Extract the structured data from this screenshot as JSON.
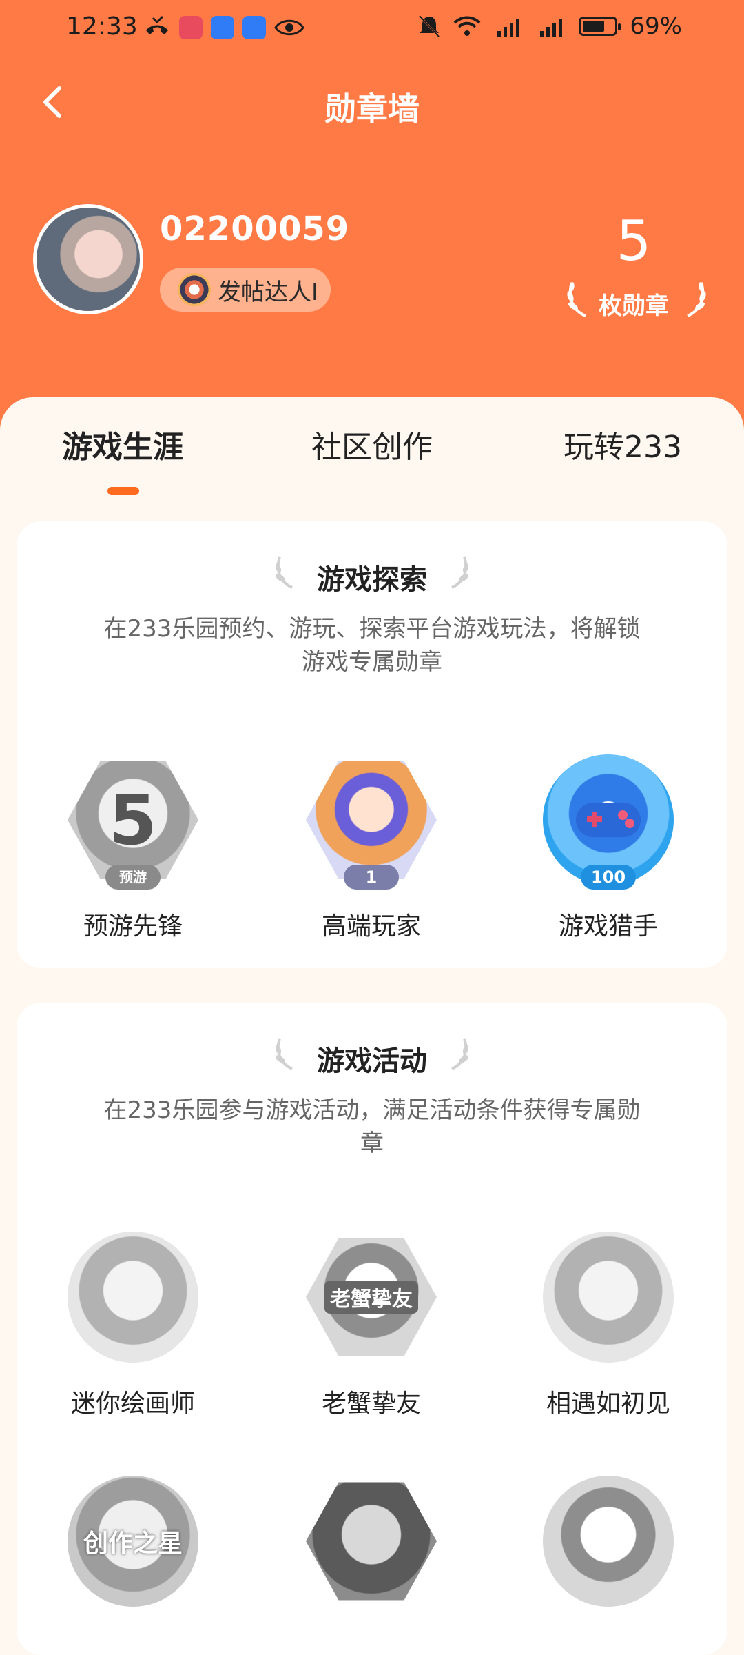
{
  "status_bar": {
    "time": "12:33",
    "battery_pct": "69%",
    "battery_level": 0.69
  },
  "header": {
    "title": "勋章墙"
  },
  "profile": {
    "user_id": "02200059",
    "badge_tag": "发帖达人I",
    "medal_count": "5",
    "medal_count_label": "枚勋章"
  },
  "tabs": [
    {
      "label": "游戏生涯",
      "active": true
    },
    {
      "label": "社区创作",
      "active": false
    },
    {
      "label": "玩转233",
      "active": false
    }
  ],
  "sections": [
    {
      "title": "游戏探索",
      "description": "在233乐园预约、游玩、探索平台游戏玩法，将解锁游戏专属勋章",
      "badges": [
        {
          "name": "预游先锋",
          "icon": "number-five-badge-icon",
          "overlay": "5",
          "sub": "预游"
        },
        {
          "name": "高端玩家",
          "icon": "vr-player-badge-icon",
          "level": "1"
        },
        {
          "name": "游戏猎手",
          "icon": "gamepad-badge-icon",
          "level": "100"
        }
      ]
    },
    {
      "title": "游戏活动",
      "description": "在233乐园参与游戏活动，满足活动条件获得专属勋章",
      "badges": [
        {
          "name": "迷你绘画师",
          "icon": "painter-girl-badge-icon"
        },
        {
          "name": "老蟹挚友",
          "icon": "burger-badge-icon",
          "overlay": "老蟹挚友"
        },
        {
          "name": "相遇如初见",
          "icon": "anime-girl-badge-icon"
        },
        {
          "name": "",
          "icon": "creation-star-badge-icon",
          "overlay": "创作之星"
        },
        {
          "name": "",
          "icon": "heroes-badge-icon"
        },
        {
          "name": "",
          "icon": "princess-badge-icon"
        }
      ]
    }
  ],
  "colors": {
    "brand": "#FF7A45",
    "indicator": "#FF6A1F"
  }
}
